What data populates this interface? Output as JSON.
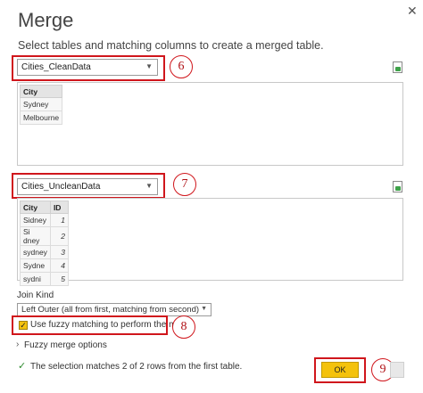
{
  "dialog": {
    "title": "Merge",
    "close_glyph": "✕",
    "subtitle": "Select tables and matching columns to create a merged table."
  },
  "table1": {
    "dropdown_value": "Cities_CleanData",
    "headers": [
      "City"
    ],
    "rows": [
      [
        "Sydney"
      ],
      [
        "Melbourne"
      ]
    ]
  },
  "table2": {
    "dropdown_value": "Cities_UncleanData",
    "headers": [
      "City",
      "ID"
    ],
    "rows": [
      [
        "Sidney",
        "1"
      ],
      [
        "Si dney",
        "2"
      ],
      [
        "sydney",
        "3"
      ],
      [
        "Sydne",
        "4"
      ],
      [
        "sydni",
        "5"
      ]
    ]
  },
  "join": {
    "label": "Join Kind",
    "value": "Left Outer (all from first, matching from second)"
  },
  "fuzzy": {
    "checkbox_label": "Use fuzzy matching to perform the merge",
    "checked": true,
    "options_label": "Fuzzy merge options"
  },
  "status": {
    "message": "The selection matches 2 of 2 rows from the first table."
  },
  "buttons": {
    "ok_label": "OK"
  },
  "annotations": {
    "marker_6": "6",
    "marker_7": "7",
    "marker_8": "8",
    "marker_9": "9",
    "color": "#d0161c"
  },
  "icons": {
    "dropdown": "chevron-down-icon",
    "file": "file-icon",
    "check": "checkmark-icon",
    "expander": "chevron-right-icon"
  }
}
